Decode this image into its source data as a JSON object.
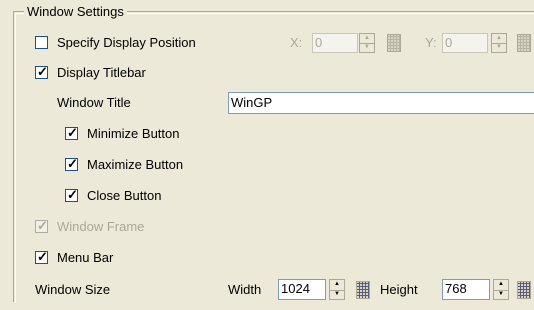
{
  "group": {
    "title": "Window Settings"
  },
  "specify_position": {
    "label": "Specify Display Position",
    "checked": false,
    "x_label": "X:",
    "x_value": "0",
    "y_label": "Y:",
    "y_value": "0"
  },
  "display_titlebar": {
    "label": "Display Titlebar",
    "checked": true
  },
  "window_title": {
    "label": "Window Title",
    "value": "WinGP"
  },
  "minimize_button": {
    "label": "Minimize Button",
    "checked": true
  },
  "maximize_button": {
    "label": "Maximize Button",
    "checked": true
  },
  "close_button": {
    "label": "Close Button",
    "checked": true
  },
  "window_frame": {
    "label": "Window Frame",
    "checked": true,
    "disabled": true
  },
  "menu_bar": {
    "label": "Menu Bar",
    "checked": true
  },
  "window_size": {
    "label": "Window Size",
    "width_label": "Width",
    "width_value": "1024",
    "height_label": "Height",
    "height_value": "768"
  },
  "glyphs": {
    "check": "✓",
    "up": "▲",
    "down": "▼"
  }
}
